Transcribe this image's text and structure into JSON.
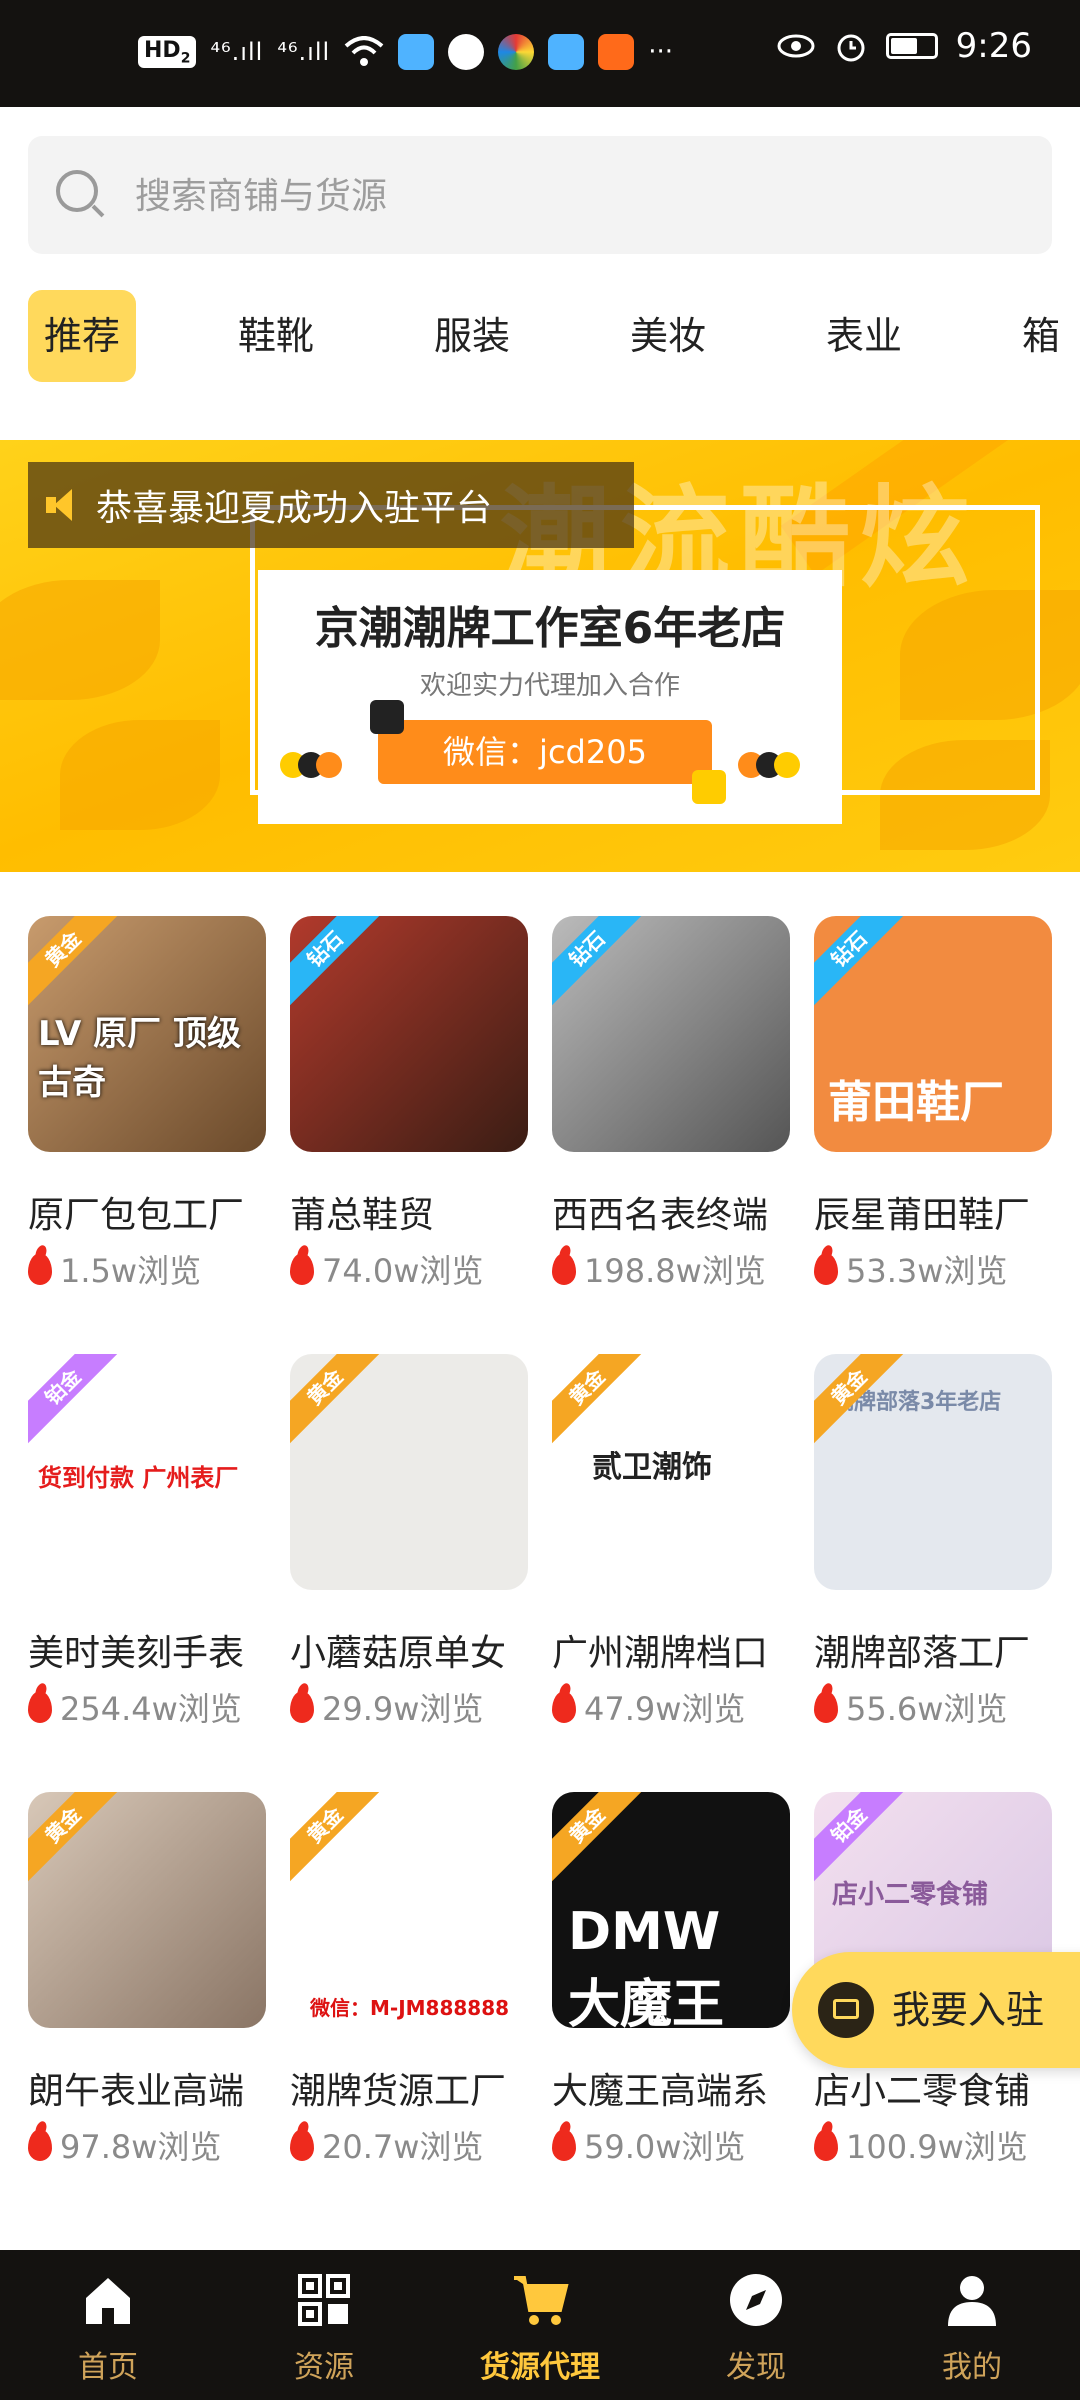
{
  "status_bar": {
    "hd_label": "HD",
    "hd_sim": "2",
    "signal1": "⁴⁶.ıll",
    "signal2": "⁴⁶.ıll",
    "more": "···",
    "time": "9:26",
    "battery_level": 0.6
  },
  "search": {
    "placeholder": "搜索商铺与货源"
  },
  "tabs": [
    {
      "label": "推荐",
      "active": true
    },
    {
      "label": "鞋靴"
    },
    {
      "label": "服装"
    },
    {
      "label": "美妆"
    },
    {
      "label": "表业"
    },
    {
      "label": "箱"
    }
  ],
  "banner": {
    "notice": "恭喜暴迎夏成功入驻平台",
    "bg_script": "潮流酷炫",
    "title": "京潮潮牌工作室6年老店",
    "subtitle": "欢迎实力代理加入合作",
    "wechat": "微信：jcd205"
  },
  "shops": [
    {
      "name": "原厂包包工厂",
      "views": "1.5w浏览",
      "badge": "黄金",
      "badge_color": "#f5a623",
      "thumb_text": "LV 原厂 顶级 古奇"
    },
    {
      "name": "莆总鞋贸",
      "views": "74.0w浏览",
      "badge": "钻石",
      "badge_color": "#29b6f6",
      "thumb_text": ""
    },
    {
      "name": "西西名表终端",
      "views": "198.8w浏览",
      "badge": "钻石",
      "badge_color": "#29b6f6",
      "thumb_text": ""
    },
    {
      "name": "辰星莆田鞋厂",
      "views": "53.3w浏览",
      "badge": "钻石",
      "badge_color": "#29b6f6",
      "thumb_text": "莆田鞋厂"
    },
    {
      "name": "美时美刻手表",
      "views": "254.4w浏览",
      "badge": "铂金",
      "badge_color": "#c77dff",
      "thumb_text": "货到付款 广州表厂"
    },
    {
      "name": "小蘑菇原单女",
      "views": "29.9w浏览",
      "badge": "黄金",
      "badge_color": "#f5a623",
      "thumb_text": ""
    },
    {
      "name": "广州潮牌档口",
      "views": "47.9w浏览",
      "badge": "黄金",
      "badge_color": "#f5a623",
      "thumb_text": "贰卫潮饰"
    },
    {
      "name": "潮牌部落工厂",
      "views": "55.6w浏览",
      "badge": "黄金",
      "badge_color": "#f5a623",
      "thumb_text": "潮牌部落3年老店"
    },
    {
      "name": "朗午表业高端",
      "views": "97.8w浏览",
      "badge": "黄金",
      "badge_color": "#f5a623",
      "thumb_text": ""
    },
    {
      "name": "潮牌货源工厂",
      "views": "20.7w浏览",
      "badge": "黄金",
      "badge_color": "#f5a623",
      "thumb_text": "微信：M-JM888888"
    },
    {
      "name": "大魔王高端系",
      "views": "59.0w浏览",
      "badge": "黄金",
      "badge_color": "#f5a623",
      "thumb_text": "DMW 大魔王"
    },
    {
      "name": "店小二零食铺",
      "views": "100.9w浏览",
      "badge": "铂金",
      "badge_color": "#c77dff",
      "thumb_text": "店小二零食铺"
    }
  ],
  "join_button": {
    "label": "我要入驻"
  },
  "tab_bar": [
    {
      "label": "首页",
      "icon": "home-icon"
    },
    {
      "label": "资源",
      "icon": "qrcode-icon"
    },
    {
      "label": "货源代理",
      "icon": "cart-icon",
      "active": true
    },
    {
      "label": "发现",
      "icon": "compass-icon"
    },
    {
      "label": "我的",
      "icon": "user-icon"
    }
  ]
}
